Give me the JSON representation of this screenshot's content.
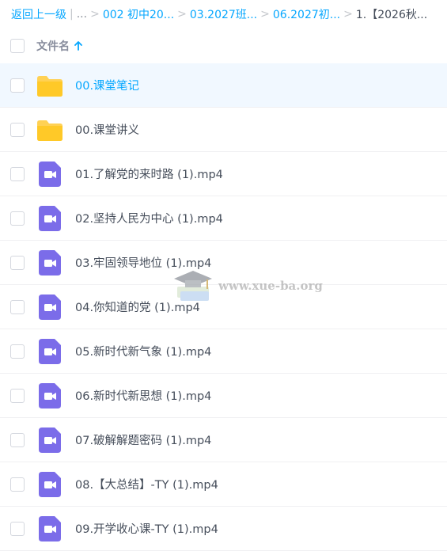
{
  "breadcrumb": {
    "back": "返回上一级",
    "dots": "...",
    "items": [
      "002 初中20...",
      "03.2027班...",
      "06.2027初..."
    ],
    "current": "1.【2026秋..."
  },
  "header": {
    "name_label": "文件名"
  },
  "files": [
    {
      "name": "00.课堂笔记",
      "type": "folder"
    },
    {
      "name": "00.课堂讲义",
      "type": "folder"
    },
    {
      "name": "01.了解党的来时路 (1).mp4",
      "type": "video"
    },
    {
      "name": "02.坚持人民为中心 (1).mp4",
      "type": "video"
    },
    {
      "name": "03.牢固领导地位 (1).mp4",
      "type": "video"
    },
    {
      "name": "04.你知道的党 (1).mp4",
      "type": "video"
    },
    {
      "name": "05.新时代新气象 (1).mp4",
      "type": "video"
    },
    {
      "name": "06.新时代新思想 (1).mp4",
      "type": "video"
    },
    {
      "name": "07.破解解题密码 (1).mp4",
      "type": "video"
    },
    {
      "name": "08.【大总结】-TY (1).mp4",
      "type": "video"
    },
    {
      "name": "09.开学收心课-TY (1).mp4",
      "type": "video"
    }
  ],
  "watermark": {
    "text": "www.xue-ba.org"
  },
  "colors": {
    "accent": "#06a7ff",
    "folder": "#ffd154",
    "video": "#7b6ce9"
  }
}
